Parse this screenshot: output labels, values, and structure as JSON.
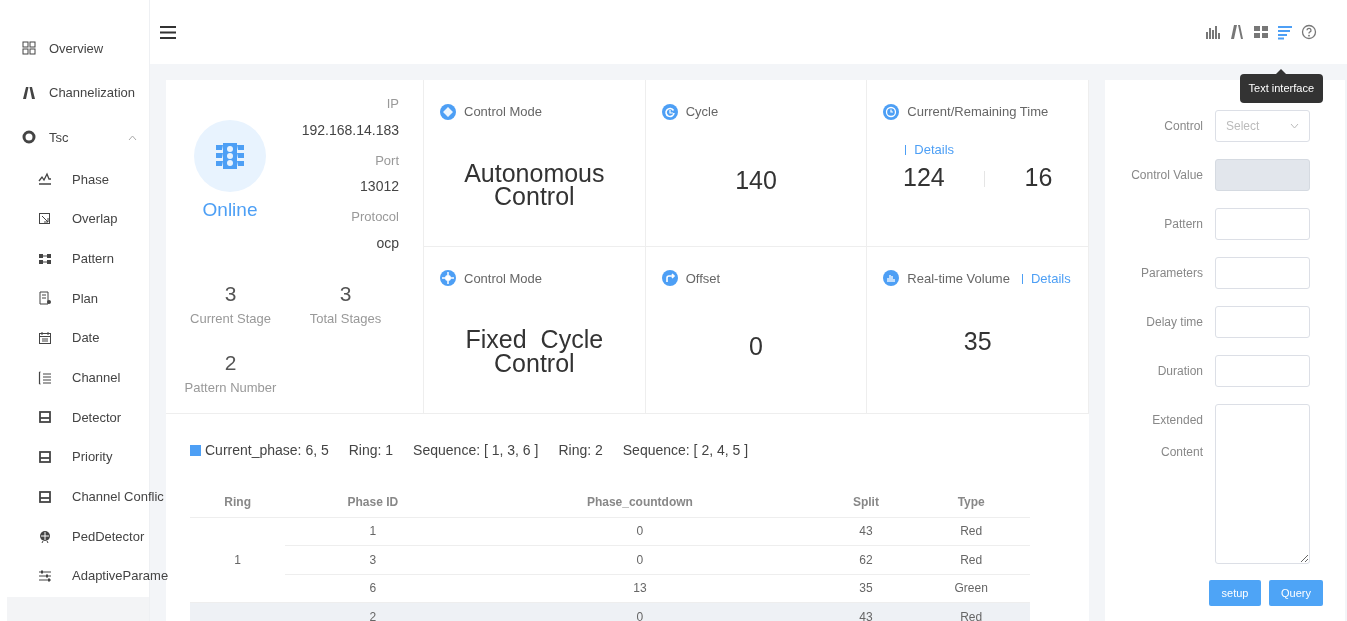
{
  "sidebar": {
    "items": [
      {
        "label": "Overview"
      },
      {
        "label": "Channelization"
      },
      {
        "label": "Tsc",
        "expanded": true,
        "children": [
          {
            "label": "Phase"
          },
          {
            "label": "Overlap"
          },
          {
            "label": "Pattern"
          },
          {
            "label": "Plan"
          },
          {
            "label": "Date"
          },
          {
            "label": "Channel"
          },
          {
            "label": "Detector"
          },
          {
            "label": "Priority"
          },
          {
            "label": "Channel Conflic"
          },
          {
            "label": "PedDetector"
          },
          {
            "label": "AdaptiveParame"
          }
        ]
      }
    ]
  },
  "toolbar": {
    "icons": [
      {
        "kind": "chart",
        "selected": false
      },
      {
        "kind": "road",
        "selected": false
      },
      {
        "kind": "grid",
        "selected": false
      },
      {
        "kind": "text",
        "selected": true
      },
      {
        "kind": "help",
        "selected": false
      }
    ],
    "tooltip": "Text interface"
  },
  "status": {
    "state": "Online",
    "ip_label": "IP",
    "ip": "192.168.14.183",
    "port_label": "Port",
    "port": "13012",
    "protocol_label": "Protocol",
    "protocol": "ocp",
    "stats": [
      {
        "value": "3",
        "label": "Current Stage"
      },
      {
        "value": "3",
        "label": "Total Stages"
      },
      {
        "value": "2",
        "label": "Pattern Number"
      }
    ]
  },
  "tiles": [
    {
      "kind": "mode",
      "title": "Control Mode",
      "value": "Autonomous Control"
    },
    {
      "kind": "single",
      "title": "Cycle",
      "value": "140"
    },
    {
      "kind": "pair",
      "title": "Current/Remaining Time",
      "link": "Details",
      "values": [
        "124",
        "16"
      ]
    },
    {
      "kind": "mode",
      "title": "Control Mode",
      "value": "Fixed  Cycle Control"
    },
    {
      "kind": "single",
      "title": "Offset",
      "value": "0"
    },
    {
      "kind": "inline",
      "title": "Real-time Volume",
      "link": "Details",
      "value": "35"
    }
  ],
  "phase_summary": [
    "Current_phase: 6, 5",
    "Ring: 1",
    "Sequence: [ 1, 3, 6 ]",
    "Ring: 2",
    "Sequence: [ 2, 4, 5 ]"
  ],
  "table": {
    "columns": [
      "Ring",
      "Phase ID",
      "Phase_countdown",
      "Split",
      "Type"
    ],
    "groups": [
      {
        "ring": "1",
        "rows": [
          {
            "phase_id": "1",
            "countdown": "0",
            "split": "43",
            "type": "Red",
            "selected": false
          },
          {
            "phase_id": "3",
            "countdown": "0",
            "split": "62",
            "type": "Red",
            "selected": false
          },
          {
            "phase_id": "6",
            "countdown": "13",
            "split": "35",
            "type": "Green",
            "selected": false
          }
        ]
      },
      {
        "rows": [
          {
            "phase_id": "2",
            "countdown": "0",
            "split": "43",
            "type": "Red",
            "selected": true
          }
        ]
      }
    ]
  },
  "form": {
    "fields": [
      {
        "kind": "select",
        "label": "Control",
        "placeholder": "Select"
      },
      {
        "kind": "input",
        "label": "Control Value",
        "disabled": true
      },
      {
        "kind": "input",
        "label": "Pattern",
        "disabled": false
      },
      {
        "kind": "input",
        "label": "Parameters",
        "disabled": false
      },
      {
        "kind": "input",
        "label": "Delay time",
        "disabled": false
      },
      {
        "kind": "input",
        "label": "Duration",
        "disabled": false
      },
      {
        "kind": "textarea",
        "label": "Extended Content"
      }
    ],
    "buttons": [
      "setup",
      "Query"
    ]
  }
}
